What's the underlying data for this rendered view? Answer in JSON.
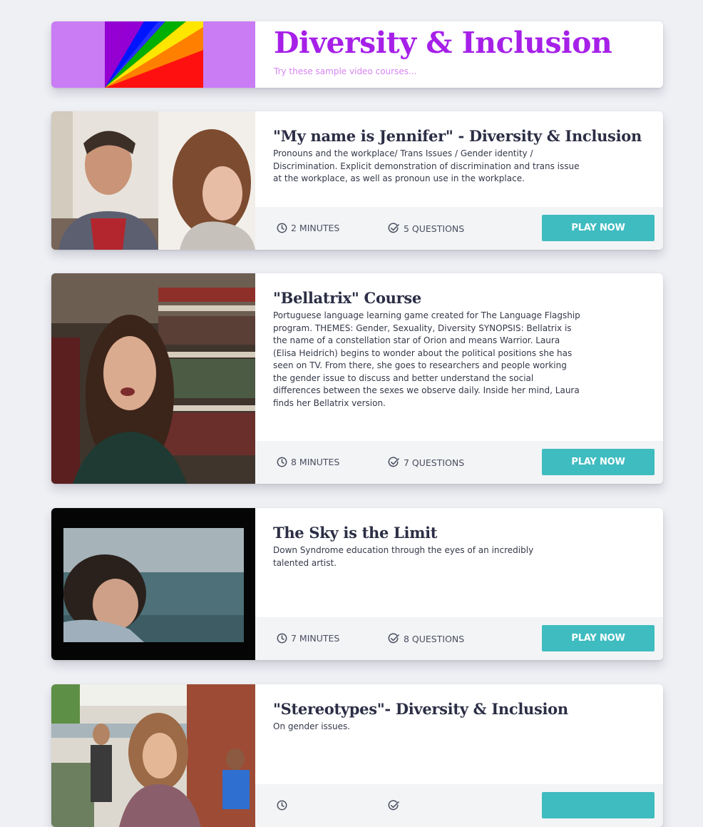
{
  "header": {
    "title": "Diversity & Inclusion",
    "subtitle": "Try these sample video courses..."
  },
  "colors": {
    "banner_bg": "#c97cf4",
    "title": "#a620e8",
    "subtitle": "#d784f2",
    "button": "#3fbcc0",
    "footer_bg": "#f3f4f6",
    "page_bg": "#eff0f4"
  },
  "courses": [
    {
      "title": "\"My name is Jennifer\" - Diversity & Inclusion",
      "description": "Pronouns and the workplace/ Trans Issues / Gender identity / Discrimination. Explicit demonstration of discrimination and trans issue at the workplace, as well as pronoun use in the workplace.",
      "duration": "2 MINUTES",
      "questions": "5 QUESTIONS",
      "button": "PLAY NOW",
      "thumbnail": "office-conversation-still"
    },
    {
      "title": "\"Bellatrix\" Course",
      "description": "Portuguese language learning game created for The Language Flagship program. THEMES: Gender, Sexuality, Diversity SYNOPSIS: Bellatrix is the name of a constellation star of Orion and means Warrior. Laura (Elisa Heidrich) begins to wonder about the political positions she has seen on TV. From there, she goes to researchers and people working the gender issue to discuss and better understand the social differences between the sexes we observe daily. Inside her mind, Laura finds her Bellatrix version.",
      "duration": "8 MINUTES",
      "questions": "7 QUESTIONS",
      "button": "PLAY NOW",
      "thumbnail": "library-interview-still"
    },
    {
      "title": "The Sky is the Limit",
      "description": "Down Syndrome education through the eyes of an incredibly talented artist.",
      "duration": "7 MINUTES",
      "questions": "8 QUESTIONS",
      "button": "PLAY NOW",
      "thumbnail": "seaside-portrait-still"
    },
    {
      "title": "\"Stereotypes\"- Diversity & Inclusion",
      "description": "On gender issues.",
      "duration": "",
      "questions": "",
      "button": "",
      "thumbnail": "schoolyard-still"
    }
  ]
}
